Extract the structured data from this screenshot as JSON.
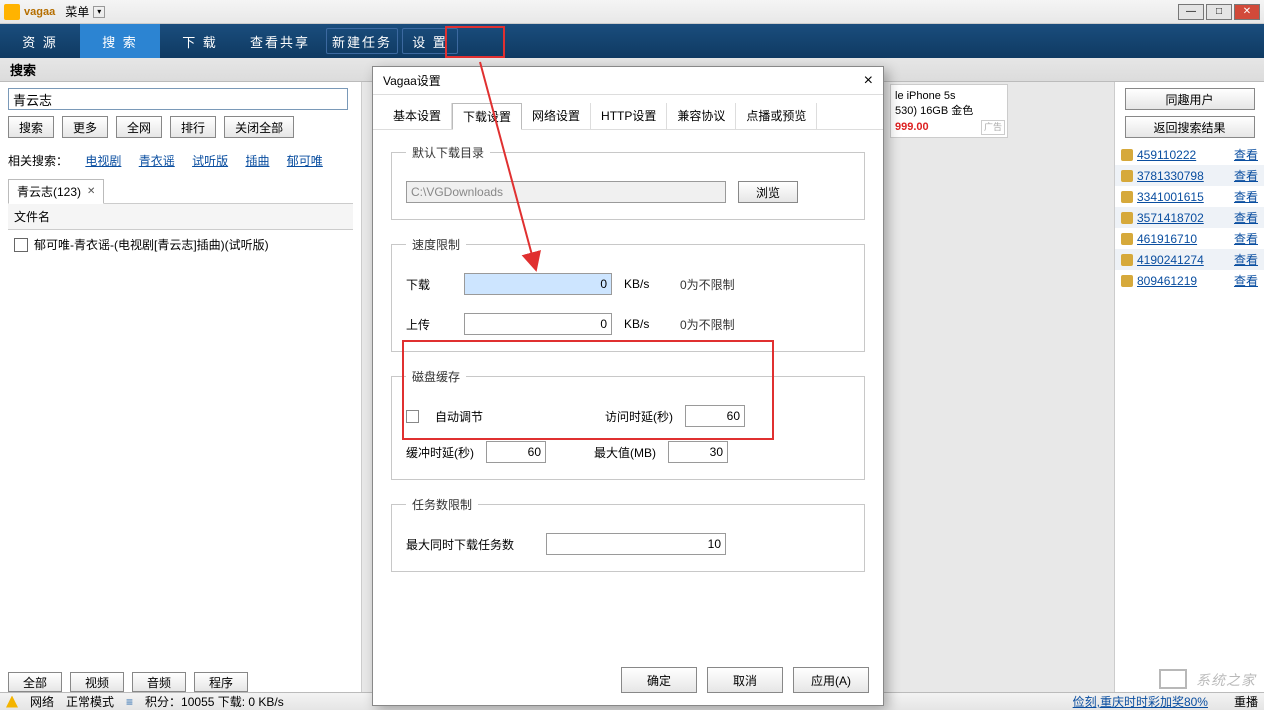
{
  "titlebar": {
    "brand": "vagaa",
    "menu": "菜单"
  },
  "toolbar": {
    "resources": "资 源",
    "search": "搜 索",
    "download": "下 载",
    "viewshare": "查看共享",
    "newtask": "新建任务",
    "settings": "设 置"
  },
  "searchHeader": "搜索",
  "searchInput": "青云志",
  "searchButtons": {
    "search": "搜索",
    "more": "更多",
    "allnet": "全网",
    "rank": "排行",
    "closeall": "关闭全部"
  },
  "related": {
    "label": "相关搜索：",
    "links": [
      "电视剧",
      "青衣谣",
      "试听版",
      "插曲",
      "郁可唯"
    ]
  },
  "fileTab": "青云志(123)",
  "colHeader": "文件名",
  "fileItem": "郁可唯-青衣谣-(电视剧[青云志]插曲)(试听版)",
  "footButtons": [
    "全部",
    "视频",
    "音频",
    "程序"
  ],
  "status": {
    "net": "网络",
    "mode": "正常模式",
    "score": "积分：10055  下载: 0 KB/s",
    "ticker": "俭刻,重庆时时彩加奖80%",
    "reset": "重播"
  },
  "rightPanel": {
    "btn1": "同趣用户",
    "btn2": "返回搜索结果",
    "users": [
      {
        "id": "459110222",
        "alt": false
      },
      {
        "id": "3781330798",
        "alt": true
      },
      {
        "id": "3341001615",
        "alt": false
      },
      {
        "id": "3571418702",
        "alt": true
      },
      {
        "id": "461916710",
        "alt": false
      },
      {
        "id": "4190241274",
        "alt": true
      },
      {
        "id": "809461219",
        "alt": false
      }
    ],
    "view": "查看"
  },
  "ad": {
    "line1": "le iPhone 5s",
    "line2": "530) 16GB 金色",
    "price": "999.00",
    "corner": "广告"
  },
  "dialog": {
    "title": "Vagaa设置",
    "tabs": [
      "基本设置",
      "下载设置",
      "网络设置",
      "HTTP设置",
      "兼容协议",
      "点播或预览"
    ],
    "activeTab": 1,
    "group_download_dir": {
      "legend": "默认下载目录",
      "path": "C:\\VGDownloads",
      "browse": "浏览"
    },
    "group_speed": {
      "legend": "速度限制",
      "dl_label": "下载",
      "dl_value": "0",
      "ul_label": "上传",
      "ul_value": "0",
      "unit": "KB/s",
      "note": "0为不限制"
    },
    "group_cache": {
      "legend": "磁盘缓存",
      "auto": "自动调节",
      "access_label": "访问时延(秒)",
      "access_val": "60",
      "buffer_label": "缓冲时延(秒)",
      "buffer_val": "60",
      "max_label": "最大值(MB)",
      "max_val": "30"
    },
    "group_tasks": {
      "legend": "任务数限制",
      "label": "最大同时下载任务数",
      "value": "10"
    },
    "buttons": {
      "ok": "确定",
      "cancel": "取消",
      "apply": "应用(A)"
    }
  },
  "watermark": "系统之家"
}
